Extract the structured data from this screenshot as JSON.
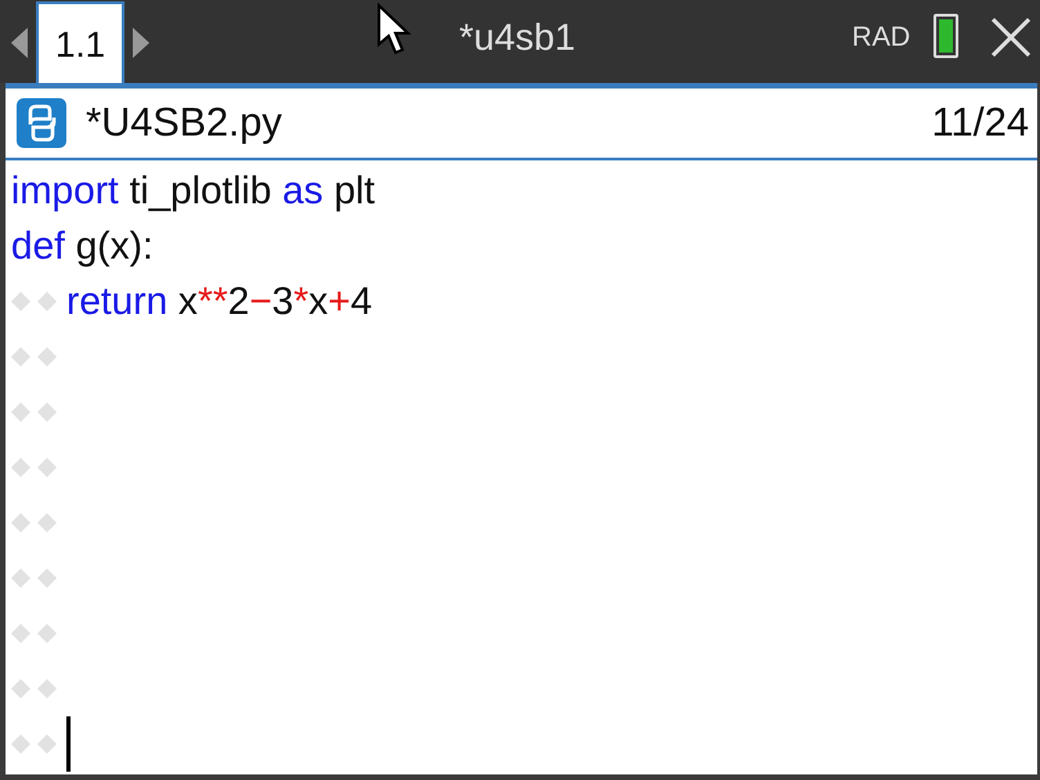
{
  "top_bar": {
    "tabs": [
      {
        "label": "1.1",
        "selected": true
      }
    ],
    "document_title": "*u4sb1",
    "angle_mode": "RAD"
  },
  "editor": {
    "file_name": "*U4SB2.py",
    "position": "11/24",
    "lines": [
      {
        "indent": false,
        "cursor": false,
        "tokens": [
          {
            "kind": "keyword",
            "text": "import"
          },
          {
            "kind": "plain",
            "text": " ti_plotlib "
          },
          {
            "kind": "keyword",
            "text": "as"
          },
          {
            "kind": "plain",
            "text": " plt"
          }
        ]
      },
      {
        "indent": false,
        "cursor": false,
        "tokens": [
          {
            "kind": "keyword",
            "text": "def"
          },
          {
            "kind": "plain",
            "text": " g(x):"
          }
        ]
      },
      {
        "indent": true,
        "cursor": false,
        "tokens": [
          {
            "kind": "keyword",
            "text": "return"
          },
          {
            "kind": "plain",
            "text": " x"
          },
          {
            "kind": "operator",
            "text": "**"
          },
          {
            "kind": "plain",
            "text": "2"
          },
          {
            "kind": "operator",
            "text": "−"
          },
          {
            "kind": "plain",
            "text": "3"
          },
          {
            "kind": "operator",
            "text": "*"
          },
          {
            "kind": "plain",
            "text": "x"
          },
          {
            "kind": "operator",
            "text": "+"
          },
          {
            "kind": "plain",
            "text": "4"
          }
        ]
      },
      {
        "indent": true,
        "cursor": false
      },
      {
        "indent": true,
        "cursor": false
      },
      {
        "indent": true,
        "cursor": false
      },
      {
        "indent": true,
        "cursor": false
      },
      {
        "indent": true,
        "cursor": false
      },
      {
        "indent": true,
        "cursor": false
      },
      {
        "indent": true,
        "cursor": false
      },
      {
        "indent": true,
        "cursor": true
      }
    ]
  }
}
